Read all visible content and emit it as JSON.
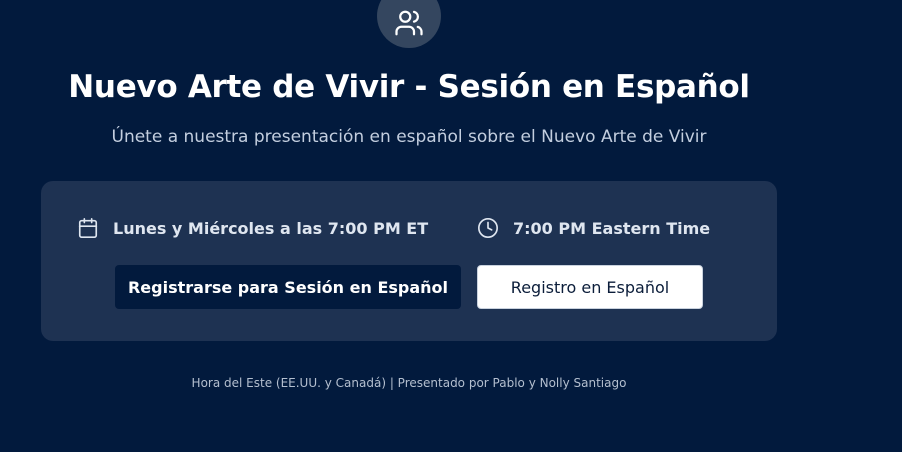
{
  "header": {
    "icon": "users-icon",
    "title": "Nuevo Arte de Vivir - Sesión en Español",
    "subtitle": "Únete a nuestra presentación en español sobre el Nuevo Arte de Vivir"
  },
  "schedule": {
    "day_icon": "calendar-icon",
    "day_text": "Lunes y Miércoles a las 7:00 PM ET",
    "time_icon": "clock-icon",
    "time_text": "7:00 PM Eastern Time"
  },
  "actions": {
    "primary_label": "Registrarse para Sesión en Español",
    "secondary_label": "Registro en Español"
  },
  "footer": {
    "text": "Hora del Este (EE.UU. y Canadá) | Presentado por Pablo y Nolly Santiago"
  },
  "colors": {
    "background": "#021a3d",
    "card": "#1e3252",
    "icon_circle": "#34465f",
    "button_primary": "#021a3d",
    "button_secondary": "#ffffff"
  }
}
